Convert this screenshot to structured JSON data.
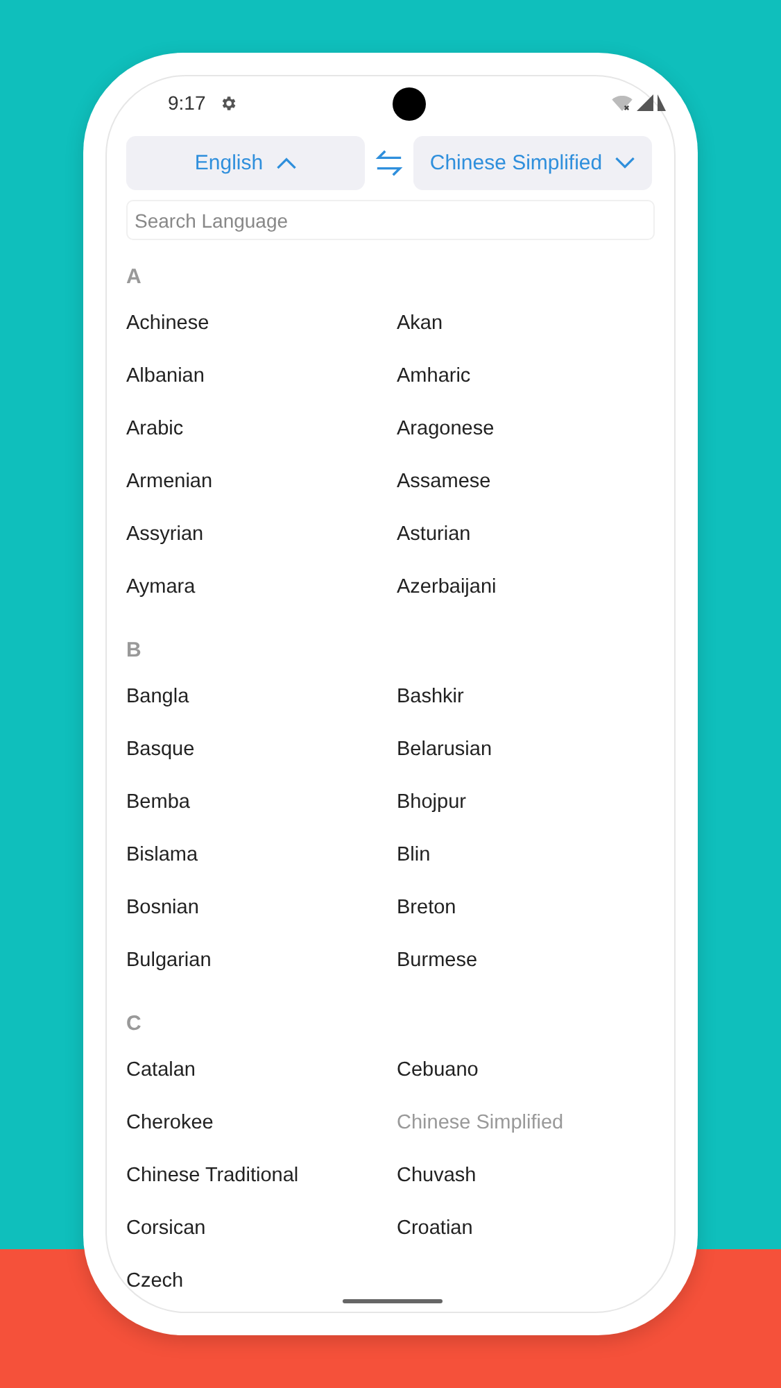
{
  "status_bar": {
    "time": "9:17"
  },
  "source_language": {
    "label": "English",
    "expanded": true
  },
  "target_language": {
    "label": "Chinese Simplified",
    "expanded": false
  },
  "search": {
    "placeholder": "Search Language"
  },
  "sections": [
    {
      "letter": "A",
      "languages": [
        {
          "name": "Achinese",
          "disabled": false
        },
        {
          "name": "Akan",
          "disabled": false
        },
        {
          "name": "Albanian",
          "disabled": false
        },
        {
          "name": "Amharic",
          "disabled": false
        },
        {
          "name": "Arabic",
          "disabled": false
        },
        {
          "name": "Aragonese",
          "disabled": false
        },
        {
          "name": "Armenian",
          "disabled": false
        },
        {
          "name": "Assamese",
          "disabled": false
        },
        {
          "name": "Assyrian",
          "disabled": false
        },
        {
          "name": "Asturian",
          "disabled": false
        },
        {
          "name": "Aymara",
          "disabled": false
        },
        {
          "name": "Azerbaijani",
          "disabled": false
        }
      ]
    },
    {
      "letter": "B",
      "languages": [
        {
          "name": "Bangla",
          "disabled": false
        },
        {
          "name": "Bashkir",
          "disabled": false
        },
        {
          "name": "Basque",
          "disabled": false
        },
        {
          "name": "Belarusian",
          "disabled": false
        },
        {
          "name": "Bemba",
          "disabled": false
        },
        {
          "name": "Bhojpur",
          "disabled": false
        },
        {
          "name": "Bislama",
          "disabled": false
        },
        {
          "name": "Blin",
          "disabled": false
        },
        {
          "name": "Bosnian",
          "disabled": false
        },
        {
          "name": "Breton",
          "disabled": false
        },
        {
          "name": "Bulgarian",
          "disabled": false
        },
        {
          "name": "Burmese",
          "disabled": false
        }
      ]
    },
    {
      "letter": "C",
      "languages": [
        {
          "name": "Catalan",
          "disabled": false
        },
        {
          "name": "Cebuano",
          "disabled": false
        },
        {
          "name": "Cherokee",
          "disabled": false
        },
        {
          "name": "Chinese Simplified",
          "disabled": true
        },
        {
          "name": "Chinese Traditional",
          "disabled": false
        },
        {
          "name": "Chuvash",
          "disabled": false
        },
        {
          "name": "Corsican",
          "disabled": false
        },
        {
          "name": "Croatian",
          "disabled": false
        },
        {
          "name": "Czech",
          "disabled": false
        }
      ]
    }
  ]
}
